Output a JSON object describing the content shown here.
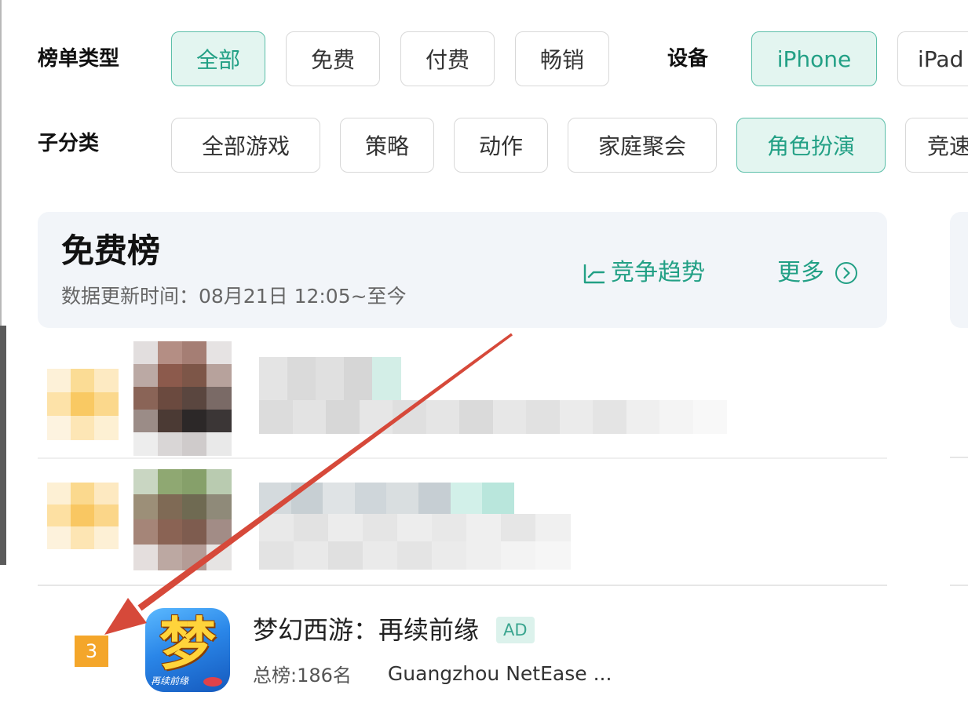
{
  "filters": {
    "list_type": {
      "label": "榜单类型",
      "options": [
        {
          "label": "全部",
          "selected": true
        },
        {
          "label": "免费",
          "selected": false
        },
        {
          "label": "付费",
          "selected": false
        },
        {
          "label": "畅销",
          "selected": false
        }
      ]
    },
    "device": {
      "label": "设备",
      "options": [
        {
          "label": "iPhone",
          "selected": true
        },
        {
          "label": "iPad",
          "selected": false
        }
      ]
    },
    "subcategory": {
      "label": "子分类",
      "options": [
        {
          "label": "全部游戏",
          "selected": false
        },
        {
          "label": "策略",
          "selected": false
        },
        {
          "label": "动作",
          "selected": false
        },
        {
          "label": "家庭聚会",
          "selected": false
        },
        {
          "label": "角色扮演",
          "selected": true
        },
        {
          "label": "竞速",
          "selected": false
        }
      ]
    }
  },
  "ranking": {
    "title": "免费榜",
    "update_time": "数据更新时间：08月21日 12:05~至今",
    "trend": {
      "label": "竞争趋势",
      "icon": "trend-chart-icon"
    },
    "more": {
      "label": "更多",
      "icon": "circle-chevron-right-icon"
    },
    "items": [
      {
        "rank": "3",
        "title": "梦幻西游：再续前缘",
        "badge": "AD",
        "overall_rank": "总榜:186名",
        "developer": "Guangzhou NetEase ...",
        "icon": {
          "glyph": "梦",
          "caption": "再续前缘"
        }
      }
    ]
  },
  "colors": {
    "accent": "#22a085",
    "selected_bg": "#e3f5f0",
    "selected_border": "#5cbfa9",
    "header_bg": "#f2f5f9",
    "rank_badge": "#f4a62a",
    "ad_bg": "#dcf2ec",
    "ad_text": "#3aa58f",
    "arrow": "#d6493a"
  }
}
